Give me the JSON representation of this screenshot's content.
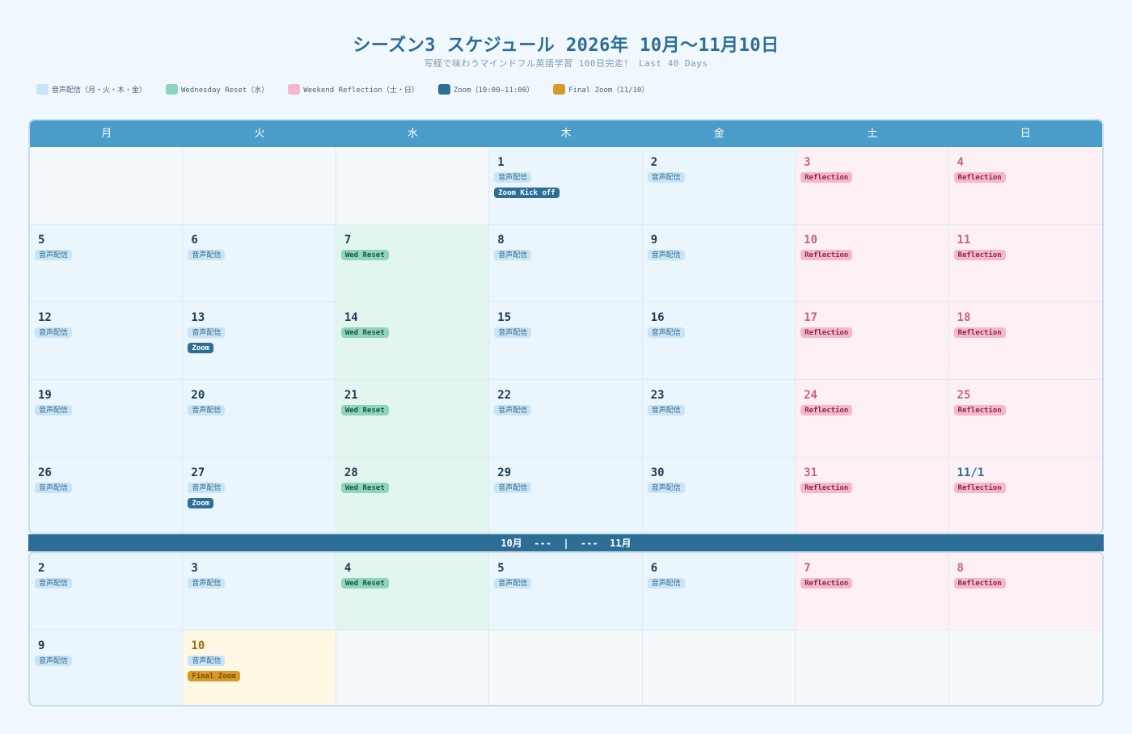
{
  "header": {
    "title": "シーズン3 スケジュール  2026年 10月〜11月10日",
    "subtitle": "写経で味わうマインドフル英語学習  100日完走！ Last 40 Days"
  },
  "legend": [
    {
      "label": "音声配信（月・火・木・金）",
      "color": "#c7e5f7"
    },
    {
      "label": "Wednesday Reset（水）",
      "color": "#8fd4bd"
    },
    {
      "label": "Weekend Reflection（土・日）",
      "color": "#f5b8ca"
    },
    {
      "label": "Zoom（10:00—11:00）",
      "color": "#2c6e96"
    },
    {
      "label": "Final Zoom（11/10）",
      "color": "#d79a2b"
    }
  ],
  "weekdays": [
    "月",
    "火",
    "水",
    "木",
    "金",
    "土",
    "日"
  ],
  "divider_label": "10月  ---  |  ---  11月",
  "october_weeks": [
    [
      {
        "type": "empty"
      },
      {
        "type": "empty"
      },
      {
        "type": "empty"
      },
      {
        "day": "1",
        "type": "weekday",
        "badges": [
          {
            "kind": "audio",
            "label": "音声配信"
          },
          {
            "kind": "zoom",
            "label": "Zoom  Kick off"
          }
        ]
      },
      {
        "day": "2",
        "type": "weekday",
        "badges": [
          {
            "kind": "audio",
            "label": "音声配信"
          }
        ]
      },
      {
        "day": "3",
        "type": "weekend",
        "badges": [
          {
            "kind": "ref",
            "label": "Reflection"
          }
        ]
      },
      {
        "day": "4",
        "type": "weekend",
        "badges": [
          {
            "kind": "ref",
            "label": "Reflection"
          }
        ]
      }
    ],
    [
      {
        "day": "5",
        "type": "weekday",
        "badges": [
          {
            "kind": "audio",
            "label": "音声配信"
          }
        ]
      },
      {
        "day": "6",
        "type": "weekday",
        "badges": [
          {
            "kind": "audio",
            "label": "音声配信"
          }
        ]
      },
      {
        "day": "7",
        "type": "wed",
        "badges": [
          {
            "kind": "wed",
            "label": "Wed Reset"
          }
        ]
      },
      {
        "day": "8",
        "type": "weekday",
        "badges": [
          {
            "kind": "audio",
            "label": "音声配信"
          }
        ]
      },
      {
        "day": "9",
        "type": "weekday",
        "badges": [
          {
            "kind": "audio",
            "label": "音声配信"
          }
        ]
      },
      {
        "day": "10",
        "type": "weekend",
        "badges": [
          {
            "kind": "ref",
            "label": "Reflection"
          }
        ]
      },
      {
        "day": "11",
        "type": "weekend",
        "badges": [
          {
            "kind": "ref",
            "label": "Reflection"
          }
        ]
      }
    ],
    [
      {
        "day": "12",
        "type": "weekday",
        "badges": [
          {
            "kind": "audio",
            "label": "音声配信"
          }
        ]
      },
      {
        "day": "13",
        "type": "weekday",
        "badges": [
          {
            "kind": "audio",
            "label": "音声配信"
          },
          {
            "kind": "zoom",
            "label": "Zoom"
          }
        ]
      },
      {
        "day": "14",
        "type": "wed",
        "badges": [
          {
            "kind": "wed",
            "label": "Wed Reset"
          }
        ]
      },
      {
        "day": "15",
        "type": "weekday",
        "badges": [
          {
            "kind": "audio",
            "label": "音声配信"
          }
        ]
      },
      {
        "day": "16",
        "type": "weekday",
        "badges": [
          {
            "kind": "audio",
            "label": "音声配信"
          }
        ]
      },
      {
        "day": "17",
        "type": "weekend",
        "badges": [
          {
            "kind": "ref",
            "label": "Reflection"
          }
        ]
      },
      {
        "day": "18",
        "type": "weekend",
        "badges": [
          {
            "kind": "ref",
            "label": "Reflection"
          }
        ]
      }
    ],
    [
      {
        "day": "19",
        "type": "weekday",
        "badges": [
          {
            "kind": "audio",
            "label": "音声配信"
          }
        ]
      },
      {
        "day": "20",
        "type": "weekday",
        "badges": [
          {
            "kind": "audio",
            "label": "音声配信"
          }
        ]
      },
      {
        "day": "21",
        "type": "wed",
        "badges": [
          {
            "kind": "wed",
            "label": "Wed Reset"
          }
        ]
      },
      {
        "day": "22",
        "type": "weekday",
        "badges": [
          {
            "kind": "audio",
            "label": "音声配信"
          }
        ]
      },
      {
        "day": "23",
        "type": "weekday",
        "badges": [
          {
            "kind": "audio",
            "label": "音声配信"
          }
        ]
      },
      {
        "day": "24",
        "type": "weekend",
        "badges": [
          {
            "kind": "ref",
            "label": "Reflection"
          }
        ]
      },
      {
        "day": "25",
        "type": "weekend",
        "badges": [
          {
            "kind": "ref",
            "label": "Reflection"
          }
        ]
      }
    ],
    [
      {
        "day": "26",
        "type": "weekday",
        "badges": [
          {
            "kind": "audio",
            "label": "音声配信"
          }
        ]
      },
      {
        "day": "27",
        "type": "weekday",
        "badges": [
          {
            "kind": "audio",
            "label": "音声配信"
          },
          {
            "kind": "zoom",
            "label": "Zoom"
          }
        ]
      },
      {
        "day": "28",
        "type": "wed",
        "badges": [
          {
            "kind": "wed",
            "label": "Wed Reset"
          }
        ]
      },
      {
        "day": "29",
        "type": "weekday",
        "badges": [
          {
            "kind": "audio",
            "label": "音声配信"
          }
        ]
      },
      {
        "day": "30",
        "type": "weekday",
        "badges": [
          {
            "kind": "audio",
            "label": "音声配信"
          }
        ]
      },
      {
        "day": "31",
        "type": "weekend",
        "badges": [
          {
            "kind": "ref",
            "label": "Reflection"
          }
        ]
      },
      {
        "day": "11/1",
        "type": "weekend",
        "blue_num": true,
        "badges": [
          {
            "kind": "ref",
            "label": "Reflection"
          }
        ]
      }
    ]
  ],
  "november_weeks": [
    [
      {
        "day": "2",
        "type": "weekday",
        "badges": [
          {
            "kind": "audio",
            "label": "音声配信"
          }
        ]
      },
      {
        "day": "3",
        "type": "weekday",
        "badges": [
          {
            "kind": "audio",
            "label": "音声配信"
          }
        ]
      },
      {
        "day": "4",
        "type": "wed",
        "badges": [
          {
            "kind": "wed",
            "label": "Wed Reset"
          }
        ]
      },
      {
        "day": "5",
        "type": "weekday",
        "badges": [
          {
            "kind": "audio",
            "label": "音声配信"
          }
        ]
      },
      {
        "day": "6",
        "type": "weekday",
        "badges": [
          {
            "kind": "audio",
            "label": "音声配信"
          }
        ]
      },
      {
        "day": "7",
        "type": "weekend",
        "badges": [
          {
            "kind": "ref",
            "label": "Reflection"
          }
        ]
      },
      {
        "day": "8",
        "type": "weekend",
        "badges": [
          {
            "kind": "ref",
            "label": "Reflection"
          }
        ]
      }
    ],
    [
      {
        "day": "9",
        "type": "weekday",
        "badges": [
          {
            "kind": "audio",
            "label": "音声配信"
          }
        ]
      },
      {
        "day": "10",
        "type": "final",
        "badges": [
          {
            "kind": "audio",
            "label": "音声配信"
          },
          {
            "kind": "final",
            "label": "Final Zoom"
          }
        ]
      },
      {
        "type": "empty"
      },
      {
        "type": "empty"
      },
      {
        "type": "empty"
      },
      {
        "type": "empty"
      },
      {
        "type": "empty"
      }
    ]
  ]
}
